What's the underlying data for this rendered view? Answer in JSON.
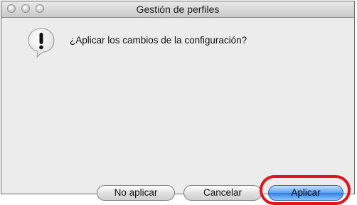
{
  "window": {
    "title": "Gestión de perfiles"
  },
  "dialog": {
    "icon": "alert-caution-icon",
    "message": "¿Aplicar los cambios de la configuración?"
  },
  "buttons": {
    "no_apply": "No aplicar",
    "cancel": "Cancelar",
    "apply": "Aplicar"
  },
  "colors": {
    "highlight": "#e2141c",
    "default_button": "#2f7fe3"
  }
}
